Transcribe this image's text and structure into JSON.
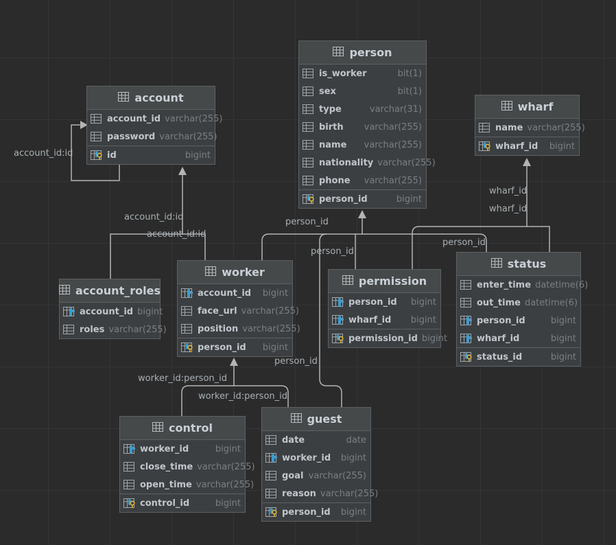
{
  "tables": {
    "person": {
      "title": "person",
      "columns": [
        {
          "name": "is_worker",
          "type": "bit(1)",
          "icon": "column-icon"
        },
        {
          "name": "sex",
          "type": "bit(1)",
          "icon": "column-icon"
        },
        {
          "name": "type",
          "type": "varchar(31)",
          "icon": "column-icon"
        },
        {
          "name": "birth",
          "type": "varchar(255)",
          "icon": "column-icon"
        },
        {
          "name": "name",
          "type": "varchar(255)",
          "icon": "column-icon"
        },
        {
          "name": "nationality",
          "type": "varchar(255)",
          "icon": "column-icon"
        },
        {
          "name": "phone",
          "type": "varchar(255)",
          "icon": "column-icon"
        }
      ],
      "key": {
        "name": "person_id",
        "type": "bigint",
        "icon": "primary-key-icon"
      }
    },
    "account": {
      "title": "account",
      "columns": [
        {
          "name": "account_id",
          "type": "varchar(255)",
          "icon": "column-icon"
        },
        {
          "name": "password",
          "type": "varchar(255)",
          "icon": "column-icon"
        }
      ],
      "key": {
        "name": "id",
        "type": "bigint",
        "icon": "primary-key-icon"
      }
    },
    "wharf": {
      "title": "wharf",
      "columns": [
        {
          "name": "name",
          "type": "varchar(255)",
          "icon": "column-icon"
        }
      ],
      "key": {
        "name": "wharf_id",
        "type": "bigint",
        "icon": "primary-key-icon"
      }
    },
    "account_roles": {
      "title": "account_roles",
      "columns": [
        {
          "name": "account_id",
          "type": "bigint",
          "icon": "foreign-key-icon"
        },
        {
          "name": "roles",
          "type": "varchar(255)",
          "icon": "column-icon"
        }
      ]
    },
    "worker": {
      "title": "worker",
      "columns": [
        {
          "name": "account_id",
          "type": "bigint",
          "icon": "foreign-key-icon"
        },
        {
          "name": "face_url",
          "type": "varchar(255)",
          "icon": "column-icon"
        },
        {
          "name": "position",
          "type": "varchar(255)",
          "icon": "column-icon"
        }
      ],
      "key": {
        "name": "person_id",
        "type": "bigint",
        "icon": "primary-key-icon"
      }
    },
    "permission": {
      "title": "permission",
      "columns": [
        {
          "name": "person_id",
          "type": "bigint",
          "icon": "foreign-key-icon"
        },
        {
          "name": "wharf_id",
          "type": "bigint",
          "icon": "foreign-key-icon"
        }
      ],
      "key": {
        "name": "permission_id",
        "type": "bigint",
        "icon": "primary-key-icon"
      }
    },
    "status": {
      "title": "status",
      "columns": [
        {
          "name": "enter_time",
          "type": "datetime(6)",
          "icon": "column-icon"
        },
        {
          "name": "out_time",
          "type": "datetime(6)",
          "icon": "column-icon"
        },
        {
          "name": "person_id",
          "type": "bigint",
          "icon": "foreign-key-icon"
        },
        {
          "name": "wharf_id",
          "type": "bigint",
          "icon": "foreign-key-icon"
        }
      ],
      "key": {
        "name": "status_id",
        "type": "bigint",
        "icon": "primary-key-icon"
      }
    },
    "control": {
      "title": "control",
      "columns": [
        {
          "name": "worker_id",
          "type": "bigint",
          "icon": "foreign-key-icon"
        },
        {
          "name": "close_time",
          "type": "varchar(255)",
          "icon": "column-icon"
        },
        {
          "name": "open_time",
          "type": "varchar(255)",
          "icon": "column-icon"
        }
      ],
      "key": {
        "name": "control_id",
        "type": "bigint",
        "icon": "primary-key-icon"
      }
    },
    "guest": {
      "title": "guest",
      "columns": [
        {
          "name": "date",
          "type": "date",
          "icon": "column-icon"
        },
        {
          "name": "worker_id",
          "type": "bigint",
          "icon": "foreign-key-icon"
        },
        {
          "name": "goal",
          "type": "varchar(255)",
          "icon": "column-icon"
        },
        {
          "name": "reason",
          "type": "varchar(255)",
          "icon": "column-icon"
        }
      ],
      "key": {
        "name": "person_id",
        "type": "bigint",
        "icon": "primary-key-icon"
      }
    }
  },
  "links": {
    "account_self": "account_id:id",
    "roles_account": "account_id:id",
    "worker_account": "account_id:id",
    "person_worker": "person_id",
    "person_guest": "person_id",
    "person_permission": "person_id",
    "person_status": "person_id",
    "guest_person": "person_id",
    "wharf_permission": "wharf_id",
    "wharf_status": "wharf_id",
    "worker_control": "worker_id:person_id",
    "worker_guest": "worker_id:person_id"
  },
  "colors": {
    "background": "#2b2b2b",
    "table": "#3c3f41",
    "header": "#45494a",
    "line": "#b4b4b4",
    "key": "#e0b33a",
    "fk": "#3d9ccd"
  }
}
